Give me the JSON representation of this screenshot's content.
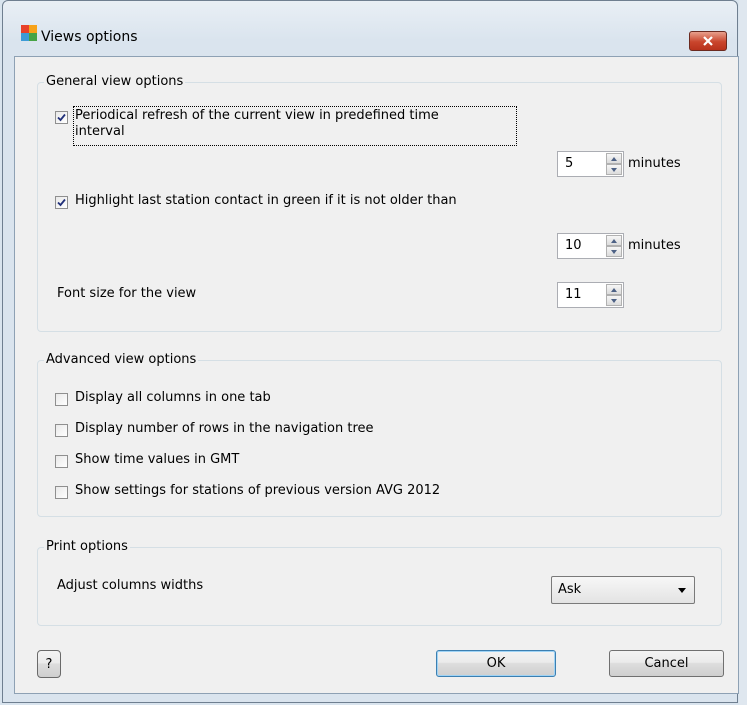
{
  "window": {
    "title": "Views options"
  },
  "general": {
    "title": "General view options",
    "refresh": {
      "checked": true,
      "label_line1": "Periodical refresh of the current view in predefined time",
      "label_line2": "interval",
      "value": "5",
      "unit": "minutes"
    },
    "highlight": {
      "checked": true,
      "label": "Highlight last station contact in green if it is not older than",
      "value": "10",
      "unit": "minutes"
    },
    "font": {
      "label": "Font size for the view",
      "value": "11"
    }
  },
  "advanced": {
    "title": "Advanced view options",
    "options": [
      {
        "label": "Display all columns in one tab",
        "checked": false
      },
      {
        "label": "Display number of rows in the navigation tree",
        "checked": false
      },
      {
        "label": "Show time values in GMT",
        "checked": false
      },
      {
        "label": "Show settings for stations of previous version AVG 2012",
        "checked": false
      }
    ]
  },
  "print": {
    "title": "Print options",
    "adjust_label": "Adjust columns widths",
    "adjust_value": "Ask"
  },
  "buttons": {
    "help": "?",
    "ok": "OK",
    "cancel": "Cancel"
  },
  "colors": {
    "checkmark": "#21307a",
    "close": "#c9452c",
    "accent_border": "#3c7fb1"
  }
}
